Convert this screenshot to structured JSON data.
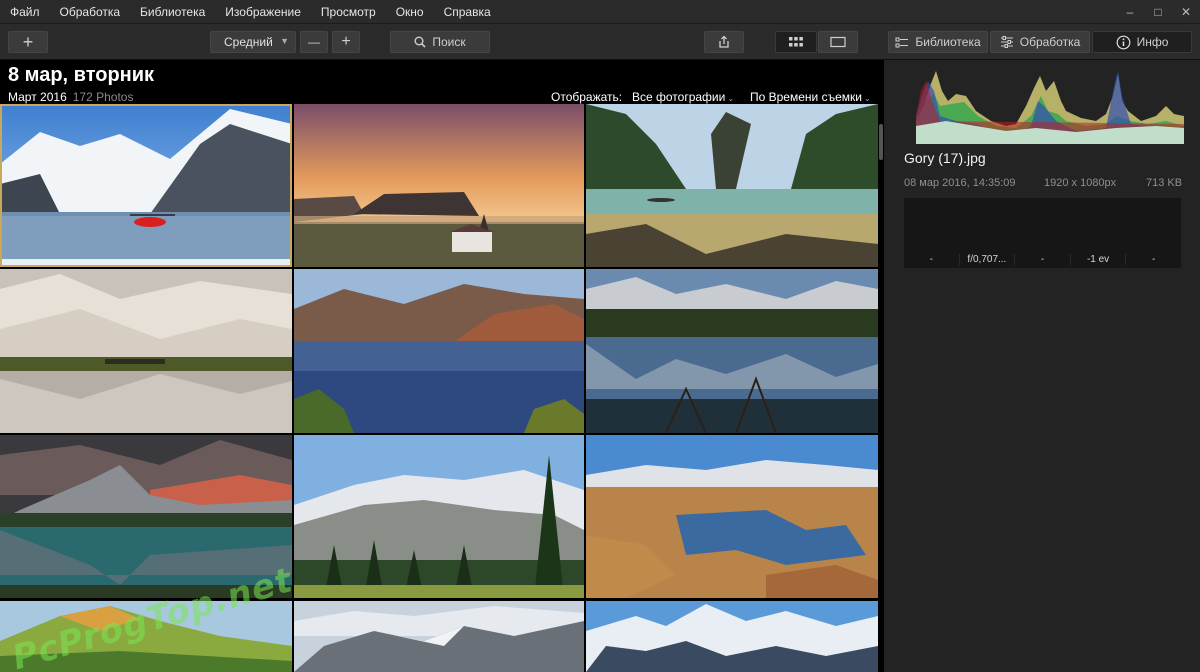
{
  "menu": [
    "Файл",
    "Обработка",
    "Библиотека",
    "Изображение",
    "Просмотр",
    "Окно",
    "Справка"
  ],
  "window": {
    "minimize": "–",
    "maximize": "□",
    "close": "✕"
  },
  "toolbar": {
    "add_label": "+",
    "zoom_value": "Средний",
    "zoom_out": "—",
    "zoom_in": "+",
    "search_label": "Поиск"
  },
  "tabs": {
    "library": "Библиотека",
    "edit": "Обработка",
    "info": "Инфо",
    "active": "info"
  },
  "gallery": {
    "date_title": "8 мар, вторник",
    "month": "Март 2016",
    "count": "172 Photos",
    "show_label": "Отображать:",
    "filter_value": "Все фотографии",
    "sort_value": "По Времени съемки",
    "photos": [
      "glacier-helicopter",
      "church-sunset",
      "island-rock",
      "desert-dunes",
      "lake-mountains",
      "mountain-reflection",
      "dramatic-peak",
      "snowy-ridge",
      "autumn-marsh",
      "green-mountain",
      "cloudy-alps",
      "snow-peaks"
    ]
  },
  "info": {
    "file_name": "Gory (17).jpg",
    "date": "08 мар 2016, 14:35:09",
    "resolution": "1920 x 1080px",
    "size": "713 KB",
    "exif": [
      "-",
      "f/0,707...",
      "-",
      "-1 ev",
      "-"
    ]
  },
  "watermark": "PcProgTop.net",
  "colors": {
    "accent_selection": "#c9a85c",
    "panel_bg": "#232323",
    "toolbar_bg": "#2b2b2b"
  }
}
